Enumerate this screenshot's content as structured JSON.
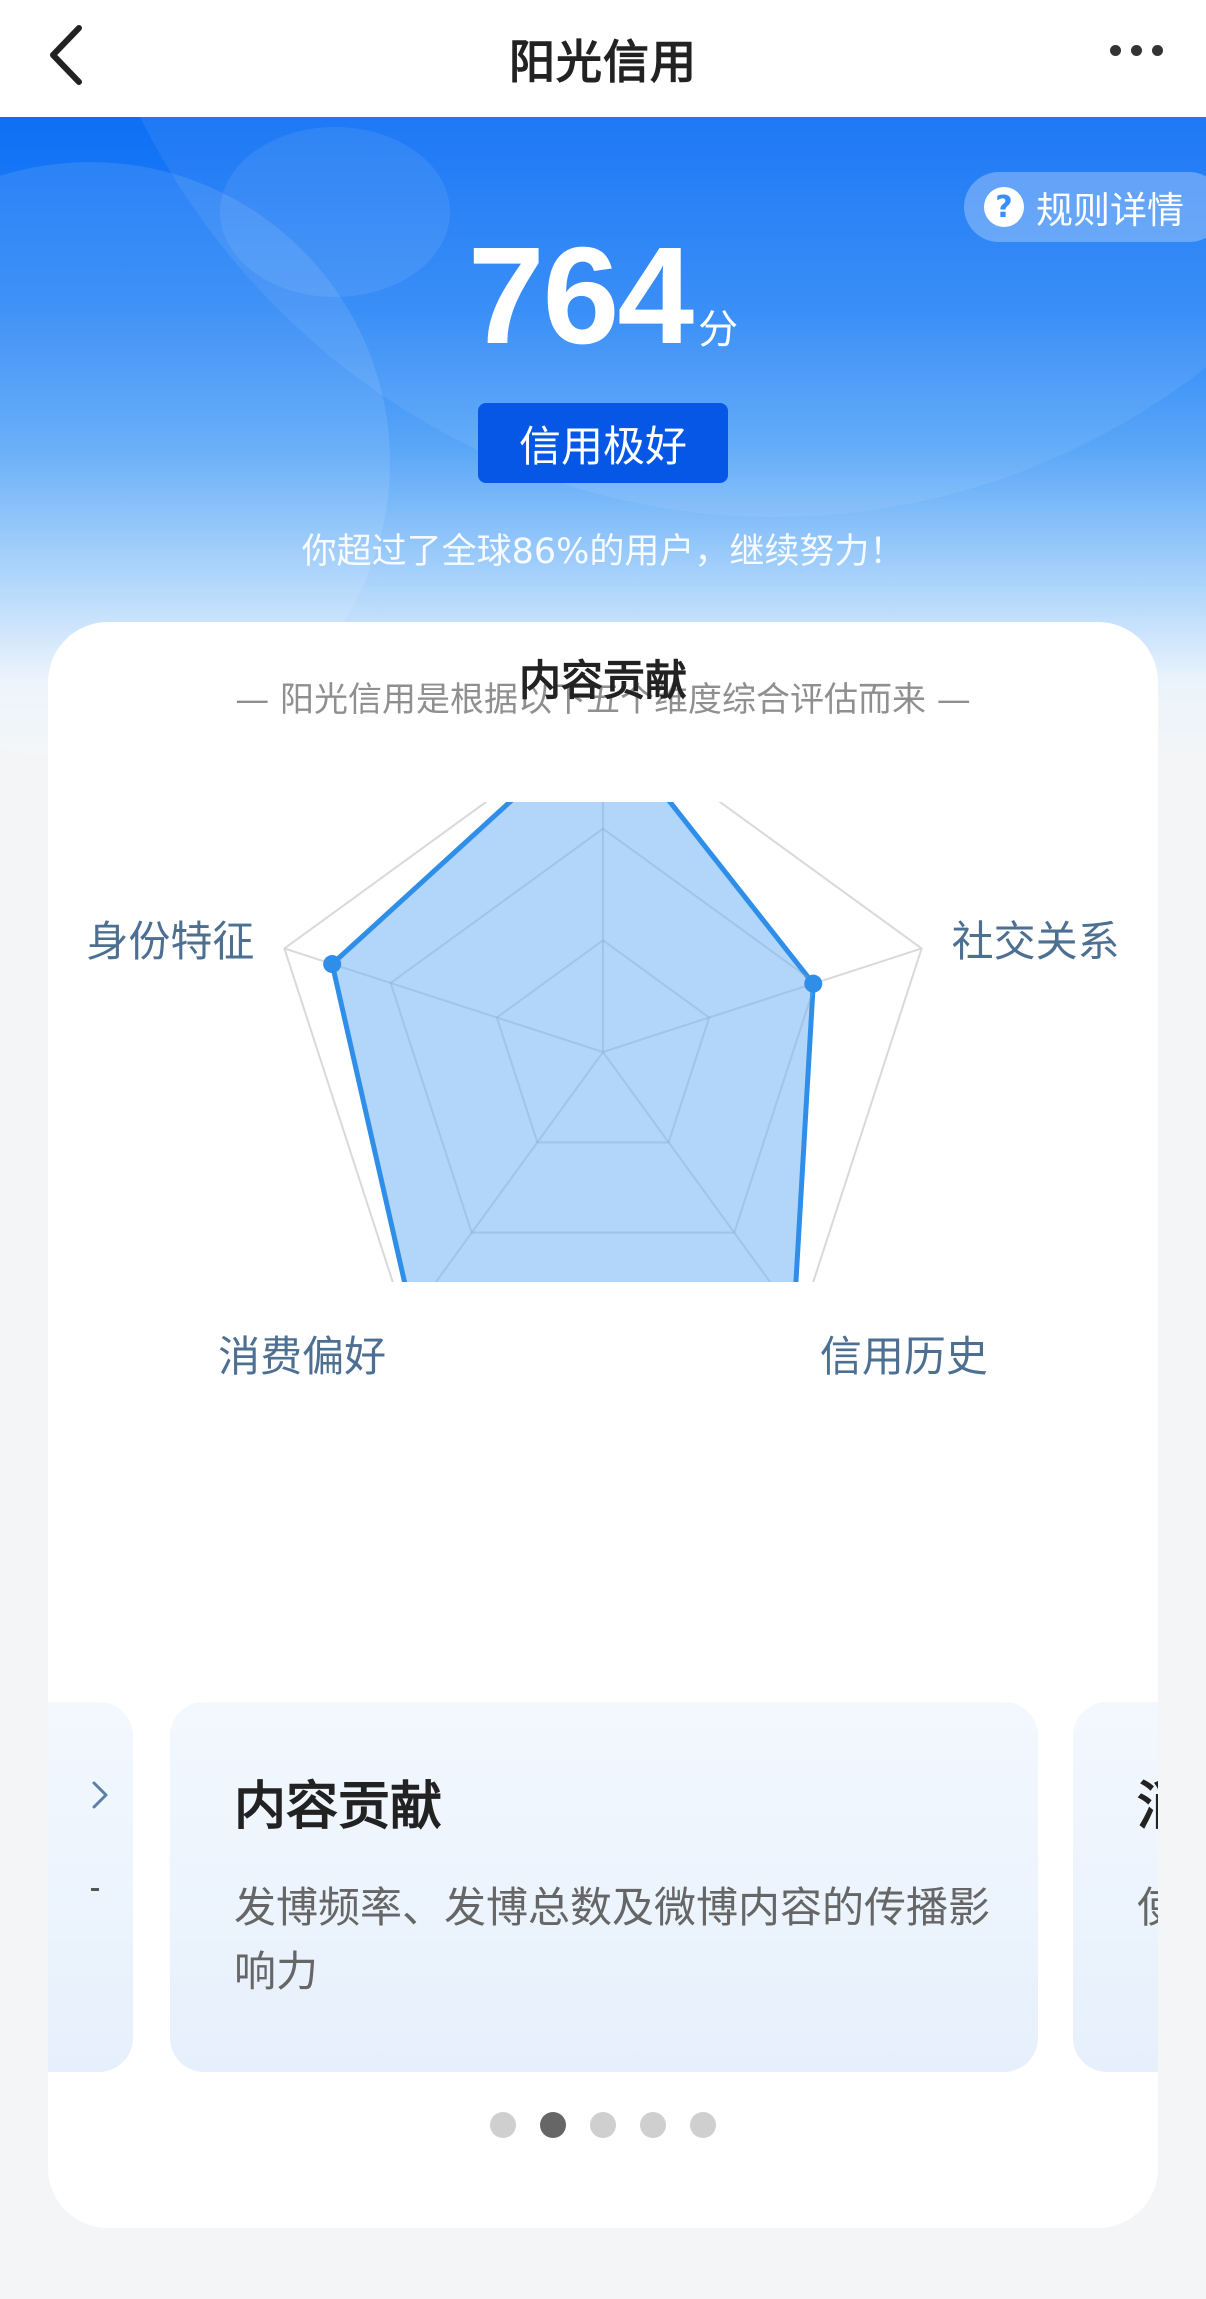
{
  "nav": {
    "title": "阳光信用"
  },
  "hero": {
    "rules_label": "规则详情",
    "rules_icon_glyph": "?",
    "score": "764",
    "score_unit": "分",
    "level": "信用极好",
    "rank_text": "你超过了全球86%的用户，继续努力！"
  },
  "card": {
    "subtitle": "— 阳光信用是根据以下五个维度综合评估而来 —"
  },
  "radar": {
    "axes": [
      {
        "label": "内容贡献",
        "value": 1.0,
        "active": true
      },
      {
        "label": "社交关系",
        "value": 0.66
      },
      {
        "label": "信用历史",
        "value": 0.97
      },
      {
        "label": "消费偏好",
        "value": 0.97
      },
      {
        "label": "身份特征",
        "value": 0.85
      }
    ],
    "grid_levels": 3,
    "fill_color": "#a8d1f8",
    "stroke_color": "#2f8ee8",
    "grid_color": "#d9d9d9"
  },
  "carousel": {
    "slides": [
      {
        "title": "内容贡献",
        "desc": "发博频率、发博总数及微博内容的传播影响力"
      },
      {
        "title": "消费偏好",
        "desc": "使用"
      }
    ],
    "page_count": 5,
    "active_index": 1
  },
  "colors": {
    "accent": "#0d6ff5",
    "badge": "#0757e6"
  }
}
